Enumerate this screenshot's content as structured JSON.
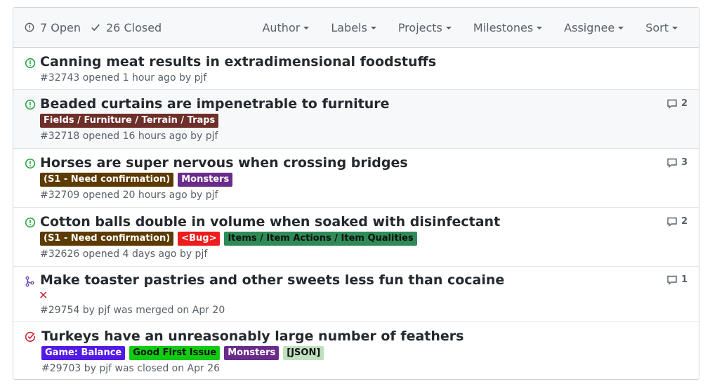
{
  "header": {
    "open_label": "7 Open",
    "closed_label": "26 Closed",
    "filters": [
      "Author",
      "Labels",
      "Projects",
      "Milestones",
      "Assignee",
      "Sort"
    ]
  },
  "colors": {
    "open": "#28a745",
    "merged": "#6f42c1",
    "closed": "#cb2431"
  },
  "issues": [
    {
      "title": "Canning meat results in extradimensional foodstuffs",
      "meta": "#32743 opened 1 hour ago by pjf",
      "status": "open-issue-icon",
      "comments": ""
    },
    {
      "title": "Beaded curtains are impenetrable to furniture",
      "meta": "#32718 opened 16 hours ago by pjf",
      "status": "open-issue-icon",
      "comments": "2",
      "labels": [
        {
          "text": "Fields / Furniture / Terrain / Traps",
          "bg": "#6e2e2a",
          "fg": "#ffffff"
        }
      ]
    },
    {
      "title": "Horses are super nervous when crossing bridges",
      "meta": "#32709 opened 20 hours ago by pjf",
      "status": "open-issue-icon",
      "comments": "3",
      "labels": [
        {
          "text": "(S1 - Need confirmation)",
          "bg": "#5c3a00",
          "fg": "#ffffff"
        },
        {
          "text": "Monsters",
          "bg": "#6a2c8a",
          "fg": "#ffffff"
        }
      ]
    },
    {
      "title": "Cotton balls double in volume when soaked with disinfectant",
      "meta": "#32626 opened 4 days ago by pjf",
      "status": "open-issue-icon",
      "comments": "2",
      "labels": [
        {
          "text": "(S1 - Need confirmation)",
          "bg": "#5c3a00",
          "fg": "#ffffff"
        },
        {
          "text": "<Bug>",
          "bg": "#ee1c1c",
          "fg": "#ffffff"
        },
        {
          "text": "Items / Item Actions / Item Qualities",
          "bg": "#2e8b57",
          "fg": "#111111"
        }
      ]
    },
    {
      "title": "Make toaster pastries and other sweets less fun than cocaine",
      "meta": "#29754 by pjf was merged on Apr 20",
      "status": "merged-pr-icon",
      "comments": "1",
      "check": "✕"
    },
    {
      "title": "Turkeys have an unreasonably large number of feathers",
      "meta": "#29703 by pjf was closed on Apr 26",
      "status": "closed-issue-icon",
      "comments": "",
      "labels": [
        {
          "text": "Game: Balance",
          "bg": "#5319e7",
          "fg": "#ffffff"
        },
        {
          "text": "Good First Issue",
          "bg": "#10cc10",
          "fg": "#111111"
        },
        {
          "text": "Monsters",
          "bg": "#6a2c8a",
          "fg": "#ffffff"
        },
        {
          "text": "[JSON]",
          "bg": "#c0e0c0",
          "fg": "#111111"
        }
      ]
    }
  ]
}
